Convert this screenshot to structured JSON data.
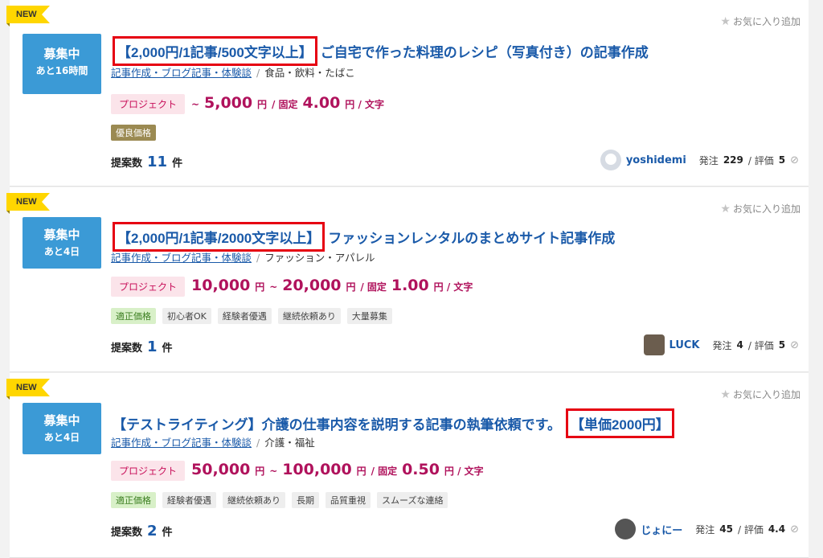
{
  "ui": {
    "new_label": "NEW",
    "fav_label": "お気に入り追加",
    "proposals_label": "提案数",
    "proposals_unit": "件",
    "order_label": "発注",
    "rating_label": "/ 評価",
    "project_tag": "プロジェクト",
    "accent_color": "#1a5aa9",
    "highlight_color": "#e60012"
  },
  "jobs": [
    {
      "status": "募集中",
      "time_left": "あと16時間",
      "title_highlight": "【2,000円/1記事/500文字以上】",
      "title_rest": "ご自宅で作った料理のレシピ（写真付き）の記事作成",
      "category": "記事作成・ブログ記事・体験談",
      "subcategory": "食品・飲料・たばこ",
      "price_from_prefix": "~",
      "price_from": "5,000",
      "price_yen": "円",
      "price_fixed_label": "/ 固定",
      "price_per": "4.00",
      "price_per_unit": "円 / 文字",
      "tags": [
        "優良価格"
      ],
      "proposals": "11",
      "client": "yoshidemi",
      "orders": "229",
      "rating": "5"
    },
    {
      "status": "募集中",
      "time_left": "あと4日",
      "title_highlight": "【2,000円/1記事/2000文字以上】",
      "title_rest": "ファッションレンタルのまとめサイト記事作成",
      "category": "記事作成・ブログ記事・体験談",
      "subcategory": "ファッション・アパレル",
      "price_min": "10,000",
      "price_max": "20,000",
      "price_yen": "円",
      "price_tilde": "~",
      "price_fixed_label": "/ 固定",
      "price_per": "1.00",
      "price_per_unit": "円 / 文字",
      "tags": [
        "適正価格",
        "初心者OK",
        "経験者優遇",
        "継続依頼あり",
        "大量募集"
      ],
      "proposals": "1",
      "client": "LUCK",
      "orders": "4",
      "rating": "5"
    },
    {
      "status": "募集中",
      "time_left": "あと4日",
      "title_rest": "【テストライティング】介護の仕事内容を説明する記事の執筆依頼です。",
      "title_highlight": "【単価2000円】",
      "category": "記事作成・ブログ記事・体験談",
      "subcategory": "介護・福祉",
      "price_min": "50,000",
      "price_max": "100,000",
      "price_yen": "円",
      "price_tilde": "~",
      "price_fixed_label": "/ 固定",
      "price_per": "0.50",
      "price_per_unit": "円 / 文字",
      "tags": [
        "適正価格",
        "経験者優遇",
        "継続依頼あり",
        "長期",
        "品質重視",
        "スムーズな連絡"
      ],
      "proposals": "2",
      "client": "じょにー",
      "orders": "45",
      "rating": "4.4"
    }
  ]
}
